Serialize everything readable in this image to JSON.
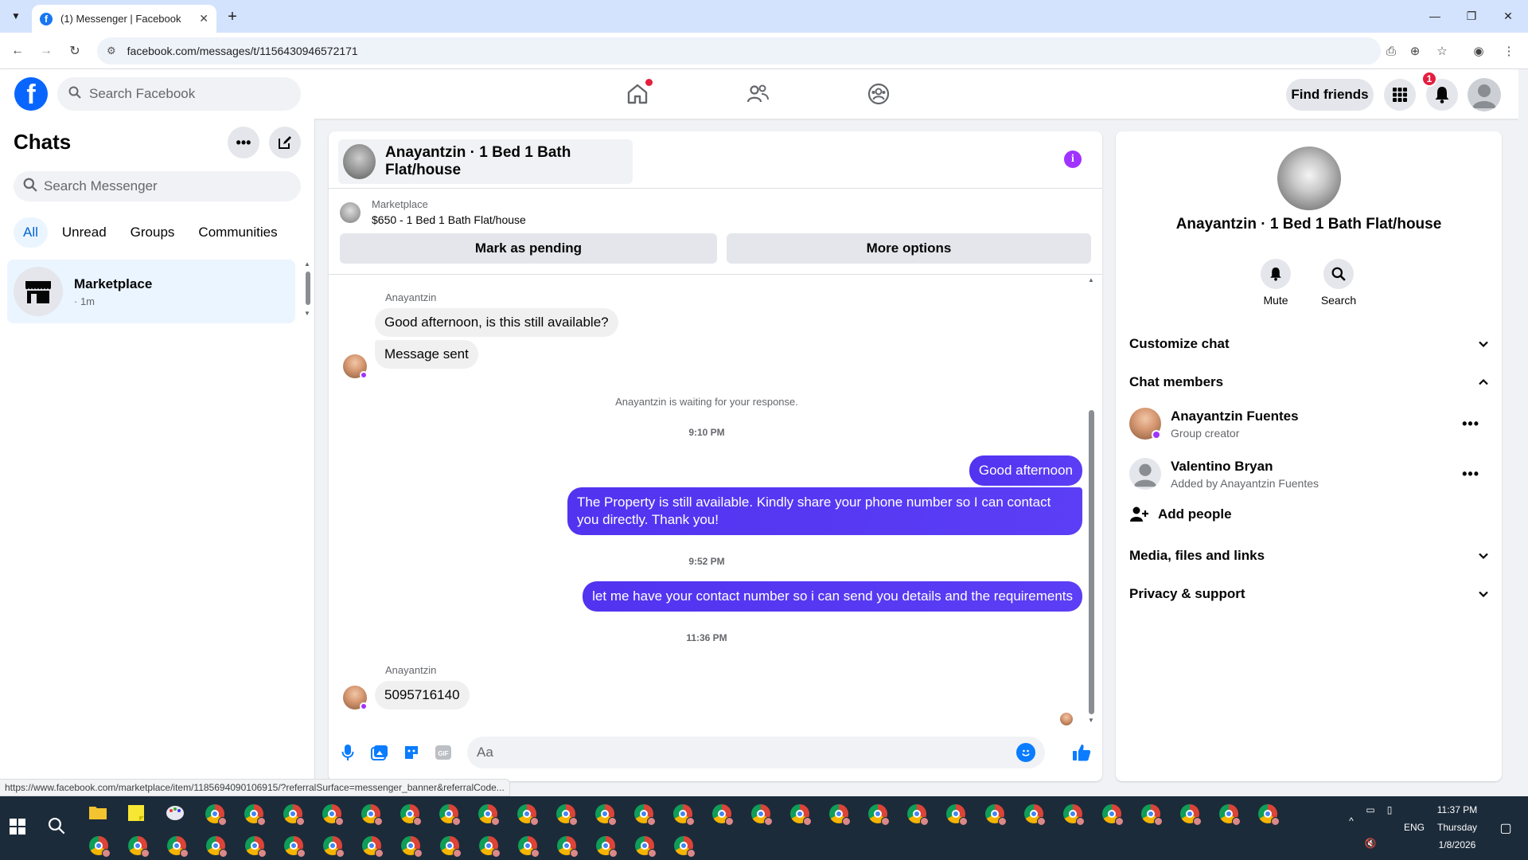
{
  "browser": {
    "tab_title": "(1) Messenger | Facebook",
    "url": "facebook.com/messages/t/1156430946572171",
    "status_url": "https://www.facebook.com/marketplace/item/1185694090106915/?referralSurface=messenger_banner&referralCode..."
  },
  "fbnav": {
    "search_placeholder": "Search Facebook",
    "find_friends": "Find friends",
    "notification_count": "1"
  },
  "sidebar": {
    "title": "Chats",
    "search_placeholder": "Search Messenger",
    "filters": [
      "All",
      "Unread",
      "Groups",
      "Communities"
    ],
    "chat": {
      "name": "Marketplace",
      "time": "· 1m"
    }
  },
  "conversation": {
    "title": "Anayantzin · 1 Bed 1 Bath Flat/house",
    "marketplace_label": "Marketplace",
    "listing": "$650 - 1 Bed 1 Bath Flat/house",
    "mark_pending": "Mark as pending",
    "more_options": "More options",
    "sender1": "Anayantzin",
    "msg1": "Good afternoon, is this still available?",
    "msg2": "Message sent",
    "waiting": "Anayantzin is waiting for your response.",
    "time1": "9:10 PM",
    "out1": "Good afternoon",
    "out2": "The Property is still available. Kindly share your phone number so I can contact you directly. Thank you!",
    "time2": "9:52 PM",
    "out3": "let me have your contact number so i can send you details and the requirements",
    "time3": "11:36 PM",
    "sender2": "Anayantzin",
    "msg3": "5095716140",
    "composer_placeholder": "Aa"
  },
  "details": {
    "name": "Anayantzin · 1 Bed 1 Bath Flat/house",
    "mute": "Mute",
    "search": "Search",
    "customize": "Customize chat",
    "members_title": "Chat members",
    "members": [
      {
        "name": "Anayantzin Fuentes",
        "role": "Group creator"
      },
      {
        "name": "Valentino Bryan",
        "role": "Added by Anayantzin Fuentes"
      }
    ],
    "add_people": "Add people",
    "media": "Media, files and links",
    "privacy": "Privacy & support"
  },
  "taskbar": {
    "lang": "ENG",
    "time": "11:37 PM",
    "day": "Thursday",
    "date": "1/8/2026"
  },
  "colors": {
    "accent": "#0866ff",
    "outgoing_bubble": "#5b3ef5",
    "info_icon": "#a033ff",
    "badge": "#e41e3f"
  }
}
